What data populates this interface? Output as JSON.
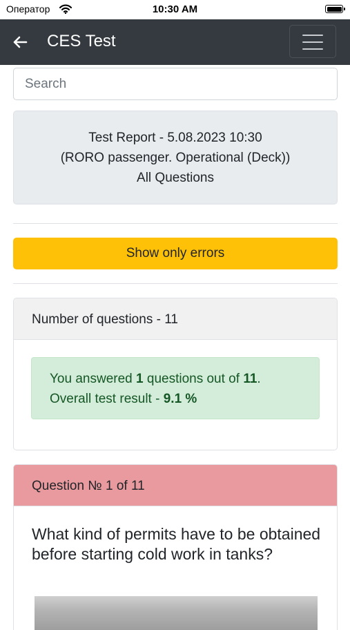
{
  "status_bar": {
    "carrier": "Оператор",
    "time": "10:30 AM"
  },
  "navbar": {
    "title": "CES Test",
    "back_icon": "arrow-left-icon",
    "menu_icon": "hamburger-menu-icon"
  },
  "search": {
    "placeholder": "Search"
  },
  "report": {
    "line1": "Test Report - 5.08.2023 10:30",
    "line2": "(RORO passenger. Operational (Deck))",
    "line3": "All Questions"
  },
  "filter_button": {
    "label": "Show only errors"
  },
  "summary": {
    "header": "Number of questions - 11",
    "answered_prefix": "You answered ",
    "answered_count": "1",
    "answered_middle": " questions out of ",
    "total": "11",
    "answered_suffix": ".",
    "result_prefix": "Overall test result - ",
    "result_value": "9.1 %"
  },
  "question": {
    "header": "Question № 1 of 11",
    "text": "What kind of permits have to be obtained before starting cold work in tanks?"
  },
  "colors": {
    "navbar": "#343a40",
    "warning": "#ffc107",
    "success_bg": "#d4edda",
    "success_text": "#155724",
    "error_header": "#e99a9e"
  }
}
